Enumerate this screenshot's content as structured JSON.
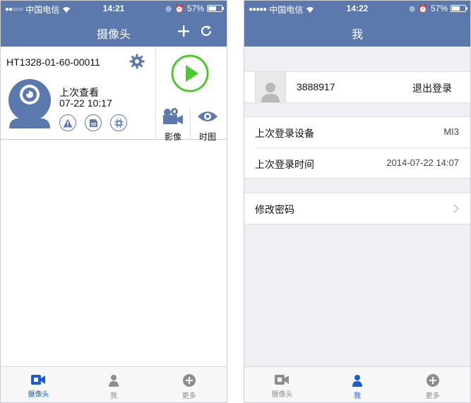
{
  "status_left": {
    "carrier": "中国电信",
    "time": "14:21",
    "battery": "57%"
  },
  "status_right": {
    "carrier": "中国电信",
    "time": "14:22",
    "battery": "57%"
  },
  "left": {
    "title": "摄像头",
    "camera": {
      "id": "HT1328-01-60-00011",
      "last_label": "上次查看",
      "last_time": "07-22 10:17",
      "video_label": "影像",
      "timeline_label": "时图"
    }
  },
  "right": {
    "title": "我",
    "account": {
      "number": "3888917",
      "logout": "退出登录"
    },
    "info": [
      {
        "key": "上次登录设备",
        "value": "MI3"
      },
      {
        "key": "上次登录时间",
        "value": "2014-07-22 14:07"
      }
    ],
    "change_password": "修改密码"
  },
  "tabs": [
    {
      "label": "摄像头",
      "icon": "camera-icon"
    },
    {
      "label": "我",
      "icon": "person-icon"
    },
    {
      "label": "更多",
      "icon": "plus-circle-icon"
    }
  ],
  "colors": {
    "accent": "#5b79ad",
    "play_green": "#4cc92e",
    "tab_active": "#1a5fd1"
  }
}
